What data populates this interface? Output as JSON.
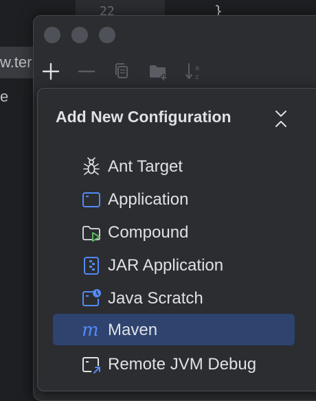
{
  "background": {
    "line_number": "22",
    "brace": "}",
    "tab_text": "w.ter",
    "side_letter": "e"
  },
  "popup": {
    "title": "Add New Configuration",
    "items": [
      {
        "label": "Ant Target",
        "icon": "ant-icon",
        "selected": false
      },
      {
        "label": "Application",
        "icon": "application-icon",
        "selected": false
      },
      {
        "label": "Compound",
        "icon": "compound-folder-icon",
        "selected": false
      },
      {
        "label": "JAR Application",
        "icon": "jar-icon",
        "selected": false
      },
      {
        "label": "Java Scratch",
        "icon": "java-scratch-icon",
        "selected": false
      },
      {
        "label": "Maven",
        "icon": "maven-icon",
        "selected": true
      },
      {
        "label": "Remote JVM Debug",
        "icon": "remote-debug-icon",
        "selected": false
      }
    ]
  },
  "colors": {
    "selected_bg": "#2e436e",
    "accent_blue": "#548af7",
    "green": "#5fb865"
  }
}
